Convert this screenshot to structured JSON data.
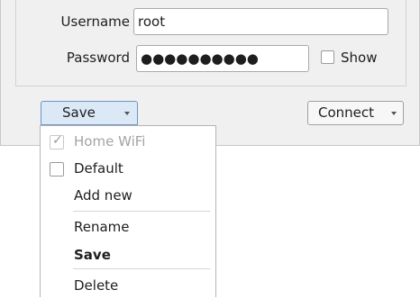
{
  "form": {
    "username_label": "Username",
    "username_value": "root",
    "password_label": "Password",
    "password_value": "●●●●●●●●●●",
    "show_label": "Show"
  },
  "buttons": {
    "save_label": "Save",
    "connect_label": "Connect"
  },
  "menu": {
    "items": [
      {
        "label": "Home WiFi",
        "checked": true,
        "disabled": true
      },
      {
        "label": "Default",
        "checked": false
      },
      {
        "label": "Add new"
      },
      {
        "label": "Rename"
      },
      {
        "label": "Save",
        "bold": true
      },
      {
        "label": "Delete"
      }
    ]
  }
}
